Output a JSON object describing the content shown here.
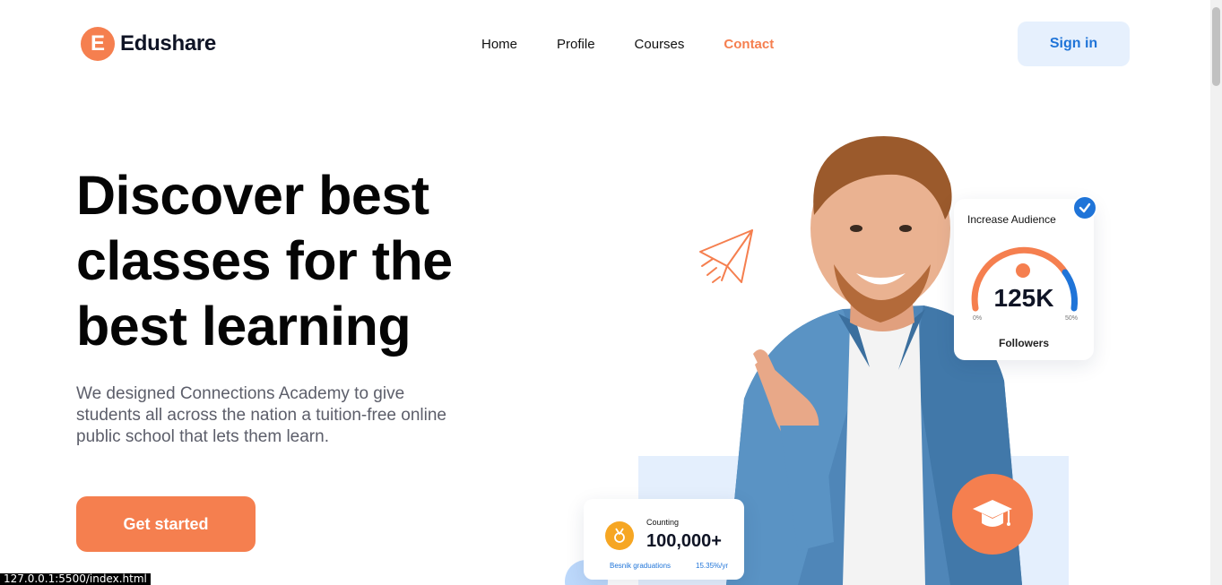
{
  "brand": {
    "logo_letter": "E",
    "name": "Edushare"
  },
  "nav": {
    "items": [
      {
        "label": "Home"
      },
      {
        "label": "Profile"
      },
      {
        "label": "Courses"
      },
      {
        "label": "Contact"
      }
    ],
    "active": "Contact"
  },
  "header": {
    "signin_label": "Sign in"
  },
  "hero": {
    "title": "Discover best classes for the best learning",
    "description": "We designed Connections Academy to give students all across the nation a tuition-free online public school that lets them learn.",
    "cta_label": "Get started"
  },
  "audience_card": {
    "title": "Increase Audience",
    "value": "125K",
    "min_label": "0%",
    "max_label": "50%",
    "label": "Followers"
  },
  "counting_card": {
    "label": "Counting",
    "value": "100,000+",
    "footer_left": "Besnik graduations",
    "footer_right": "15.35%/yr"
  },
  "status_bar": {
    "url": "127.0.0.1:5500/index.html"
  },
  "colors": {
    "accent": "#f57f4f",
    "primary_blue": "#1f74d8",
    "light_blue": "#e4effd"
  },
  "icons": [
    "logo-mark-icon",
    "paper-plane-icon",
    "check-icon",
    "medal-icon",
    "graduation-cap-icon"
  ]
}
